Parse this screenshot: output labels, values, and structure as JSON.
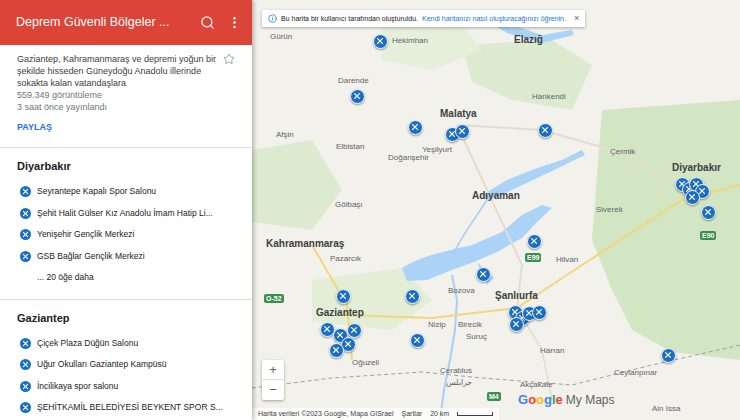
{
  "header": {
    "title": "Deprem Güvenli Bölgeler ..."
  },
  "description": "Gaziantep, Kahramanmaraş ve depremi yoğun bir şekilde hisseden Güneydoğu Anadolu illerinde sokakta kalan vatandaşlara",
  "starred": false,
  "views": "559.349 görüntüleme",
  "published": "3 saat önce yayınlandı",
  "share_button": "PAYLAŞ",
  "layers": [
    {
      "title": "Diyarbakır",
      "items": [
        "Seyrantepe Kapalı Spor Salonu",
        "Şehit Halit Gülser Kız Anadolu İmam Hatip Li...",
        "Yenişehir Gençlik Merkezi",
        "GSB Bağlar Gençlik Merkezi"
      ],
      "more": "... 20 öğe daha"
    },
    {
      "title": "Gaziantep",
      "items": [
        "Çiçek Plaza Düğün Salonu",
        "Uğur Okulları Gaziantep Kampüsü",
        "İncilikaya spor salonu",
        "ŞEHİTKAMİL BELEDİYESİ BEYKENT SPOR S..."
      ],
      "more": ""
    }
  ],
  "banner": {
    "text": "Bu harita bir kullanıcı tarafından oluşturuldu.",
    "link": "Kendi haritanızı nasıl oluşturacağınızı öğrenin.",
    "close": "×"
  },
  "map_labels": [
    {
      "text": "Gürün",
      "kind": "town"
    },
    {
      "text": "Hekimhan",
      "kind": "town"
    },
    {
      "text": "Elazığ",
      "kind": "city"
    },
    {
      "text": "Darende",
      "kind": "town"
    },
    {
      "text": "Hankendi",
      "kind": "town"
    },
    {
      "text": "Malatya",
      "kind": "city"
    },
    {
      "text": "Yeşilyurt",
      "kind": "town"
    },
    {
      "text": "Çermik",
      "kind": "town"
    },
    {
      "text": "Afşin",
      "kind": "town"
    },
    {
      "text": "Elbistan",
      "kind": "town"
    },
    {
      "text": "Doğanşehir",
      "kind": "town"
    },
    {
      "text": "Diyarbakır",
      "kind": "city"
    },
    {
      "text": "Gölbaşı",
      "kind": "town"
    },
    {
      "text": "Adıyaman",
      "kind": "city"
    },
    {
      "text": "Kahramanmaraş",
      "kind": "city"
    },
    {
      "text": "Pazarcık",
      "kind": "town"
    },
    {
      "text": "Siverek",
      "kind": "town"
    },
    {
      "text": "Hilvan",
      "kind": "town"
    },
    {
      "text": "Bozova",
      "kind": "town"
    },
    {
      "text": "Şanlıurfa",
      "kind": "city"
    },
    {
      "text": "Gaziantep",
      "kind": "city"
    },
    {
      "text": "Nizip",
      "kind": "town"
    },
    {
      "text": "Birecik",
      "kind": "town"
    },
    {
      "text": "Suruç",
      "kind": "town"
    },
    {
      "text": "Oğuzeli",
      "kind": "town"
    },
    {
      "text": "Harran",
      "kind": "town"
    },
    {
      "text": "Cerablus",
      "kind": "town"
    },
    {
      "text": "جرابلس",
      "kind": "town"
    },
    {
      "text": "Akçakale",
      "kind": "town"
    },
    {
      "text": "Ceylanpınar",
      "kind": "town"
    },
    {
      "text": "Ain Issa",
      "kind": "town"
    }
  ],
  "road_labels": [
    "E99",
    "E90",
    "O-52",
    "M4"
  ],
  "zoom": {
    "in": "+",
    "out": "−"
  },
  "logo": {
    "google": "Google",
    "product": "My Maps"
  },
  "footer": {
    "attribution": "Harita verileri ©2023 Google, Mapa GISrael",
    "terms": "Şartlar",
    "scale": "20 km"
  }
}
